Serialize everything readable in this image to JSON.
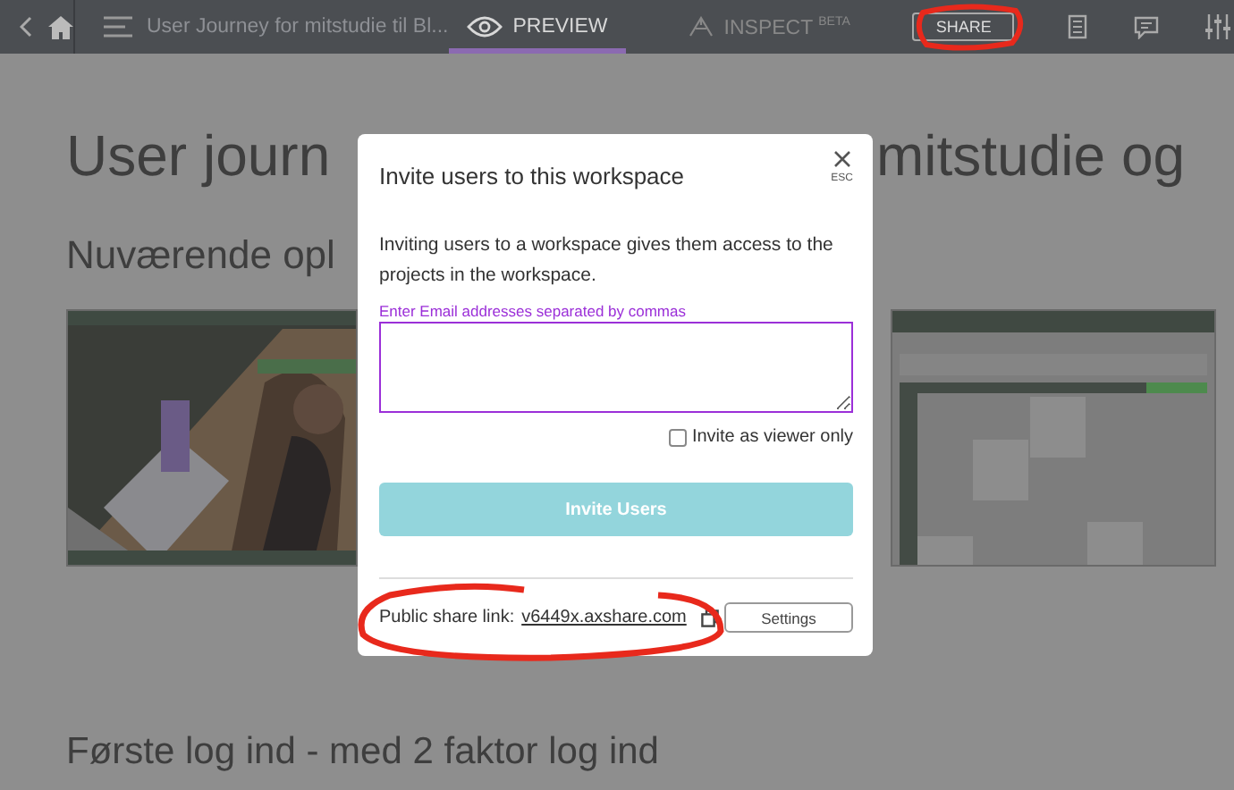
{
  "toolbar": {
    "project_title": "User Journey for mitstudie til Bl...",
    "tabs": [
      {
        "label": "PREVIEW",
        "kind": "preview",
        "selected": true
      },
      {
        "label": "INSPECT",
        "superscript": "BETA",
        "kind": "inspect",
        "selected": false
      }
    ],
    "share_button": "SHARE"
  },
  "page": {
    "heading_left": "User journ",
    "heading_right": "mitstudie og",
    "subheading": "Nuværende opl",
    "thumbnails": [
      {
        "kind": "picture"
      },
      {
        "kind": "calendar"
      }
    ],
    "section_heading": "Første log ind - med 2 faktor log ind"
  },
  "modal": {
    "title": "Invite users to this workspace",
    "close": "ESC",
    "description": "Inviting users to a workspace gives them access to the projects in the workspace.",
    "email_field": {
      "label": "Enter Email addresses separated by commas"
    },
    "viewer_only": {
      "label": "Invite as viewer only",
      "checked": false
    },
    "invite_button": {
      "label": "Invite Users",
      "disabled": true
    },
    "share_link_label": "Public share link:",
    "share_link": "v6449x.axshare.com",
    "settings_button": "Settings"
  }
}
